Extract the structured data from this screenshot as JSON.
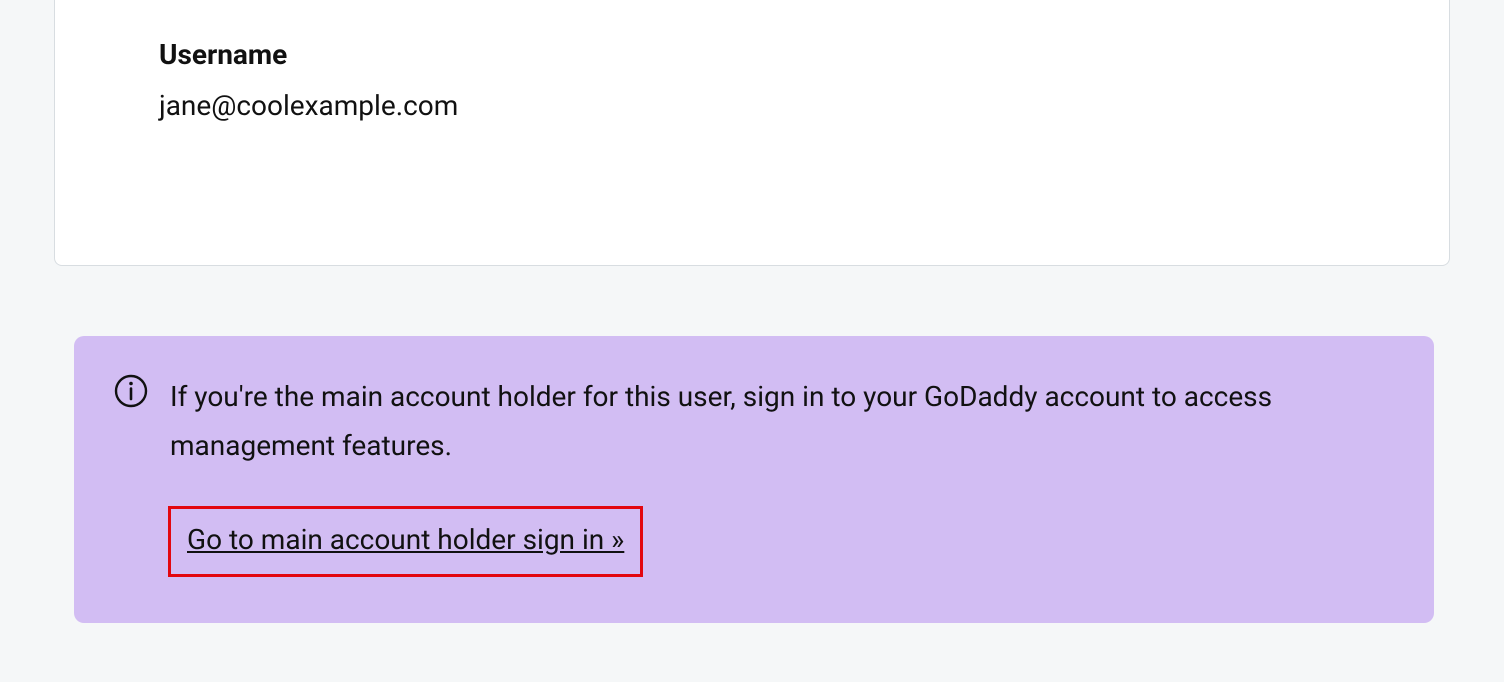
{
  "card": {
    "username_label": "Username",
    "username_value": "jane@coolexample.com"
  },
  "notice": {
    "message": "If you're the main account holder for this user, sign in to your GoDaddy account to access management features.",
    "link_text": "Go to main account holder sign in »"
  }
}
